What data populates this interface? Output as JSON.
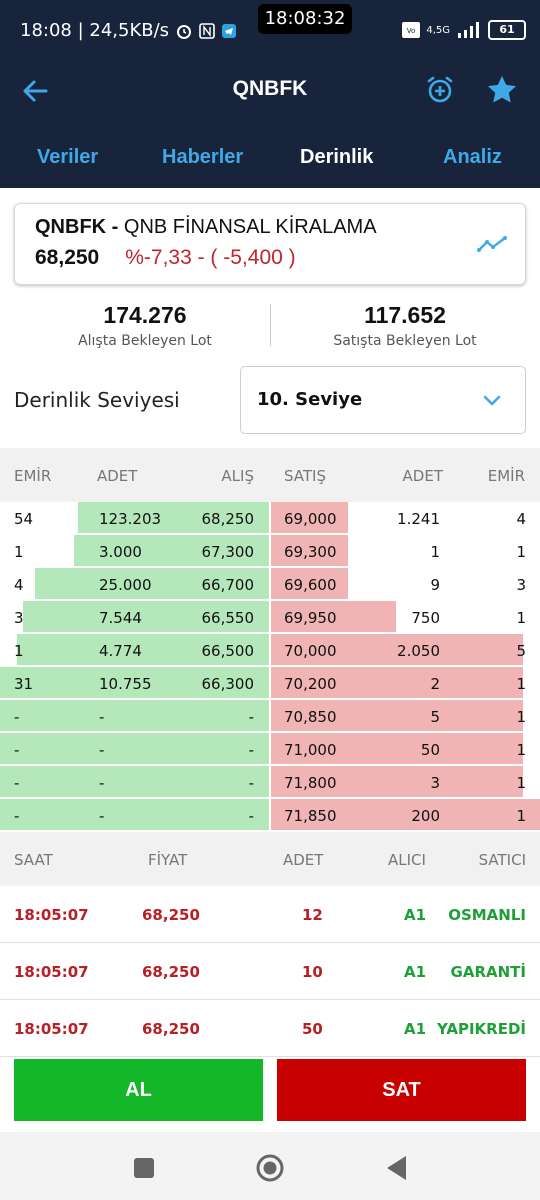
{
  "status_bar": {
    "left_text": "18:08 | 24,5KB/s",
    "clock": "18:08:32",
    "network": "4,5G",
    "battery": "61"
  },
  "app_bar": {
    "title": "QNBFK"
  },
  "tabs": [
    {
      "label": "Veriler",
      "active": false
    },
    {
      "label": "Haberler",
      "active": false
    },
    {
      "label": "Derinlik",
      "active": true
    },
    {
      "label": "Analiz",
      "active": false
    }
  ],
  "stock_card": {
    "symbol": "QNBFK -",
    "name": "QNB FİNANSAL KİRALAMA",
    "price": "68,250",
    "change": "%-7,33 - ( -5,400 )"
  },
  "summary": {
    "bid_lots": "174.276",
    "bid_label": "Alışta Bekleyen Lot",
    "ask_lots": "117.652",
    "ask_label": "Satışta Bekleyen Lot"
  },
  "depth": {
    "label": "Derinlik Seviyesi",
    "selected": "10. Seviye"
  },
  "depth_table": {
    "headers": [
      "EMİR",
      "ADET",
      "ALIŞ",
      "SATIŞ",
      "ADET",
      "EMİR"
    ],
    "rows": [
      {
        "bid_orders": "54",
        "bid_qty": "123.203",
        "bid_price": "68,250",
        "ask_price": "69,000",
        "ask_qty": "1.241",
        "ask_orders": "4"
      },
      {
        "bid_orders": "1",
        "bid_qty": "3.000",
        "bid_price": "67,300",
        "ask_price": "69,300",
        "ask_qty": "1",
        "ask_orders": "1"
      },
      {
        "bid_orders": "4",
        "bid_qty": "25.000",
        "bid_price": "66,700",
        "ask_price": "69,600",
        "ask_qty": "9",
        "ask_orders": "3"
      },
      {
        "bid_orders": "3",
        "bid_qty": "7.544",
        "bid_price": "66,550",
        "ask_price": "69,950",
        "ask_qty": "750",
        "ask_orders": "1"
      },
      {
        "bid_orders": "1",
        "bid_qty": "4.774",
        "bid_price": "66,500",
        "ask_price": "70,000",
        "ask_qty": "2.050",
        "ask_orders": "5"
      },
      {
        "bid_orders": "31",
        "bid_qty": "10.755",
        "bid_price": "66,300",
        "ask_price": "70,200",
        "ask_qty": "2",
        "ask_orders": "1"
      },
      {
        "bid_orders": "-",
        "bid_qty": "-",
        "bid_price": "-",
        "ask_price": "70,850",
        "ask_qty": "5",
        "ask_orders": "1"
      },
      {
        "bid_orders": "-",
        "bid_qty": "-",
        "bid_price": "-",
        "ask_price": "71,000",
        "ask_qty": "50",
        "ask_orders": "1"
      },
      {
        "bid_orders": "-",
        "bid_qty": "-",
        "bid_price": "-",
        "ask_price": "71,800",
        "ask_qty": "3",
        "ask_orders": "1"
      },
      {
        "bid_orders": "-",
        "bid_qty": "-",
        "bid_price": "-",
        "ask_price": "71,850",
        "ask_qty": "200",
        "ask_orders": "1"
      }
    ]
  },
  "trades_table": {
    "headers": [
      "SAAT",
      "FİYAT",
      "ADET",
      "ALICI",
      "SATICI"
    ],
    "rows": [
      {
        "time": "18:05:07",
        "price": "68,250",
        "qty": "12",
        "buyer": "A1",
        "seller": "OSMANLI"
      },
      {
        "time": "18:05:07",
        "price": "68,250",
        "qty": "10",
        "buyer": "A1",
        "seller": "GARANTİ"
      },
      {
        "time": "18:05:07",
        "price": "68,250",
        "qty": "50",
        "buyer": "A1",
        "seller": "YAPIKREDİ"
      }
    ]
  },
  "actions": {
    "buy": "AL",
    "sell": "SAT"
  },
  "colors": {
    "header_bg": "#17243c",
    "tab_inactive": "#3fa9e8",
    "bid_bar": "#b4e8bb",
    "ask_bar": "#f1b4b4",
    "buy": "#14b62a",
    "sell": "#c80000",
    "down": "#c0262b"
  }
}
